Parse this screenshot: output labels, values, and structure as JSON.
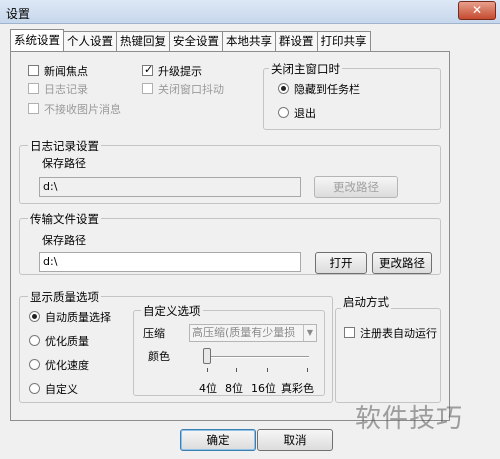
{
  "window": {
    "title": "设置",
    "close_symbol": "✕"
  },
  "tabs": [
    "系统设置",
    "个人设置",
    "热键回复",
    "安全设置",
    "本地共享",
    "群设置",
    "打印共享"
  ],
  "general": {
    "news_focus": "新闻焦点",
    "log_record": "日志记录",
    "no_image_msg": "不接收图片消息",
    "upgrade_prompt": "升级提示",
    "close_window_shake": "关闭窗口抖动"
  },
  "close_main_window": {
    "title": "关闭主窗口时",
    "options": [
      "隐藏到任务栏",
      "退出"
    ],
    "selected": "隐藏到任务栏"
  },
  "log_settings": {
    "title": "日志记录设置",
    "path_label": "保存路径",
    "path_value": "d:\\",
    "change_path_button": "更改路径"
  },
  "transfer_settings": {
    "title": "传输文件设置",
    "path_label": "保存路径",
    "path_value": "d:\\",
    "open_button": "打开",
    "change_path_button": "更改路径"
  },
  "quality": {
    "title": "显示质量选项",
    "options": [
      "自动质量选择",
      "优化质量",
      "优化速度",
      "自定义"
    ],
    "selected": "自动质量选择",
    "custom": {
      "title": "自定义选项",
      "compress_label": "压缩",
      "compress_value": "高压缩(质量有少量损",
      "color_label": "颜色",
      "color_ticks": [
        "4位",
        "8位",
        "16位",
        "真彩色"
      ],
      "color_level": 0
    }
  },
  "startup": {
    "title": "启动方式",
    "registry_autorun": "注册表自动运行"
  },
  "footer": {
    "ok": "确定",
    "cancel": "取消"
  },
  "watermark": "软件技巧"
}
